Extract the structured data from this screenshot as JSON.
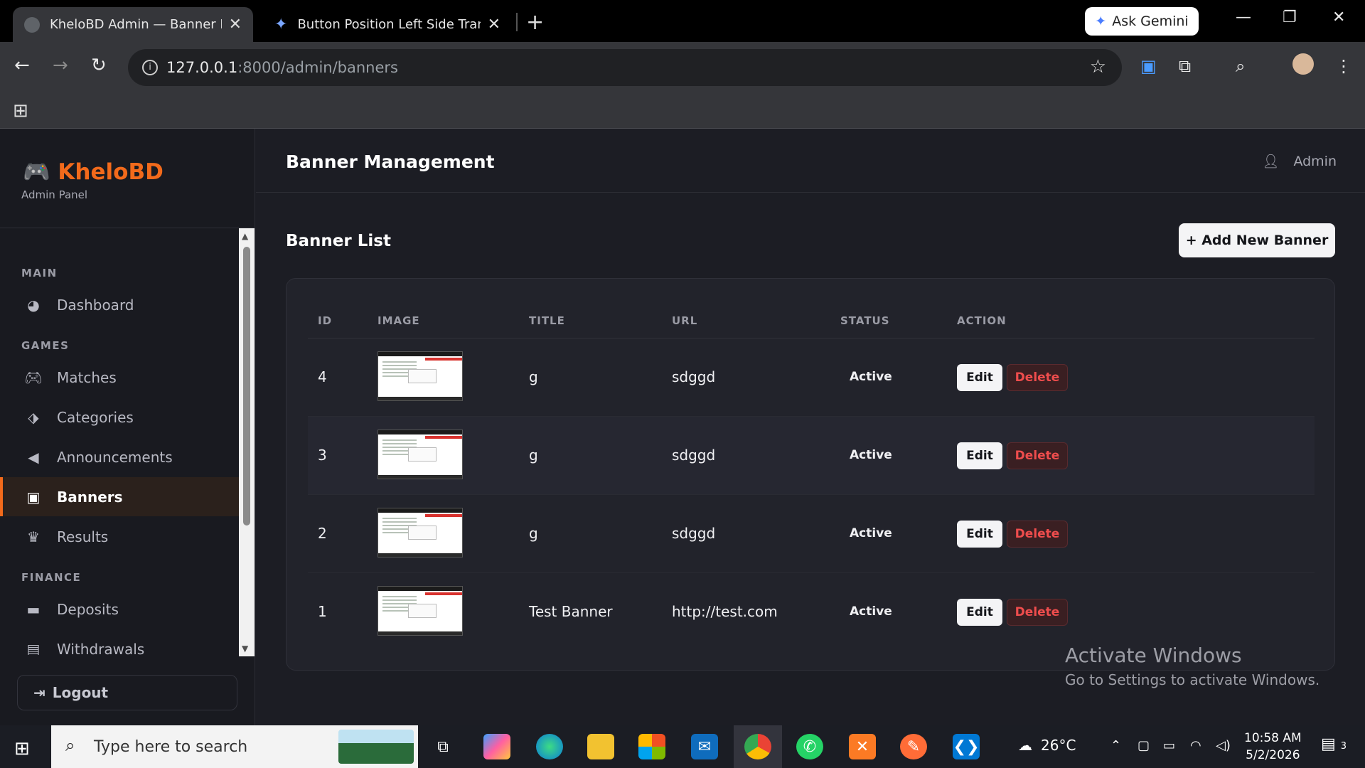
{
  "browser": {
    "tabs": [
      {
        "title": "KheloBD Admin — Banner Man",
        "active": true
      },
      {
        "title": "Button Position Left Side Transfo",
        "active": false
      }
    ],
    "gemini_label": "Ask Gemini",
    "url_host": "127.0.0.1",
    "url_rest": ":8000/admin/banners"
  },
  "sidebar": {
    "brand": "KheloBD",
    "brand_icon": "🎮",
    "subtitle": "Admin Panel",
    "sections": [
      {
        "title": "MAIN",
        "items": [
          {
            "label": "Dashboard",
            "icon": "pie-chart-icon"
          }
        ]
      },
      {
        "title": "GAMES",
        "items": [
          {
            "label": "Matches",
            "icon": "gamepad-icon"
          },
          {
            "label": "Categories",
            "icon": "tags-icon"
          },
          {
            "label": "Announcements",
            "icon": "megaphone-icon"
          },
          {
            "label": "Banners",
            "icon": "image-icon",
            "active": true
          },
          {
            "label": "Results",
            "icon": "trophy-icon"
          }
        ]
      },
      {
        "title": "FINANCE",
        "items": [
          {
            "label": "Deposits",
            "icon": "wallet-icon"
          },
          {
            "label": "Withdrawals",
            "icon": "money-icon"
          }
        ]
      }
    ],
    "logout_label": "Logout"
  },
  "header": {
    "title": "Banner Management",
    "user_label": "Admin"
  },
  "content": {
    "list_title": "Banner List",
    "add_button": "+ Add New Banner",
    "columns": [
      "ID",
      "IMAGE",
      "TITLE",
      "URL",
      "STATUS",
      "ACTION"
    ],
    "rows": [
      {
        "id": "4",
        "title": "g",
        "url": "sdggd",
        "status": "Active"
      },
      {
        "id": "3",
        "title": "g",
        "url": "sdggd",
        "status": "Active"
      },
      {
        "id": "2",
        "title": "g",
        "url": "sdggd",
        "status": "Active"
      },
      {
        "id": "1",
        "title": "Test Banner",
        "url": "http://test.com",
        "status": "Active"
      }
    ],
    "edit_label": "Edit",
    "delete_label": "Delete"
  },
  "watermark": {
    "line1": "Activate Windows",
    "line2": "Go to Settings to activate Windows."
  },
  "taskbar": {
    "search_placeholder": "Type here to search",
    "weather": "26°C",
    "time": "10:58 AM",
    "date": "5/2/2026",
    "notifications": "3"
  },
  "colors": {
    "accent": "#f26a1b",
    "danger": "#ef4d4d",
    "background": "#1c1d24"
  }
}
